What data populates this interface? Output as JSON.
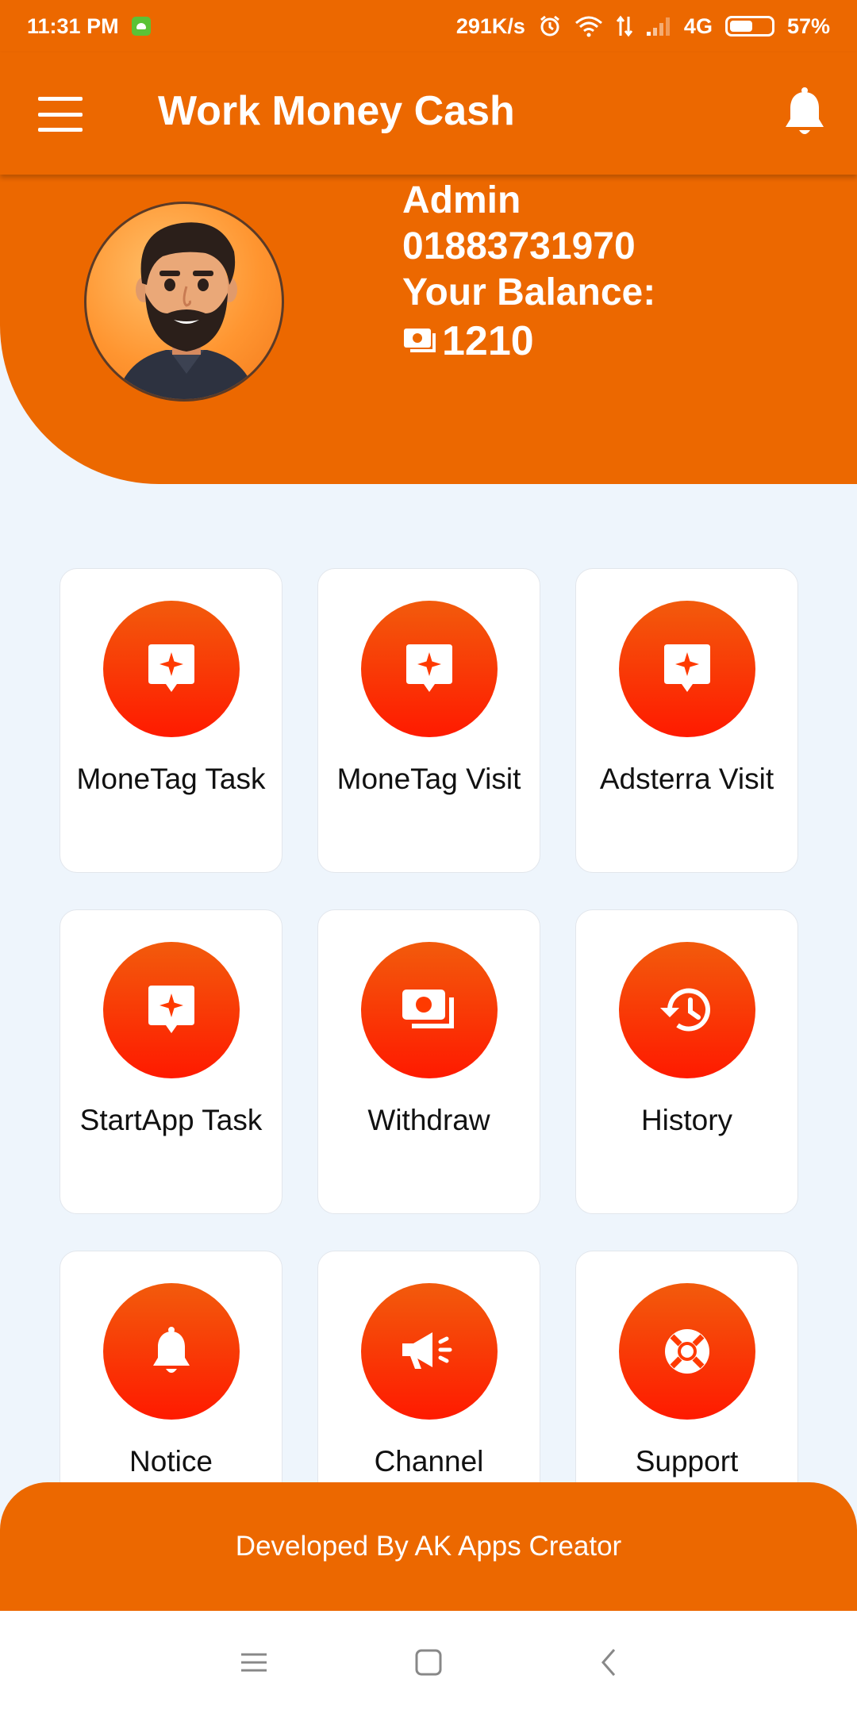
{
  "status_bar": {
    "time": "11:31 PM",
    "speed": "291K/s",
    "network": "4G",
    "battery": "57%",
    "battery_level": 0.57,
    "icons": [
      "android-notification-icon",
      "alarm-icon",
      "wifi-icon",
      "data-arrows-icon",
      "signal-icon",
      "battery-icon"
    ]
  },
  "app_bar": {
    "title": "Work Money Cash",
    "menu_icon": "hamburger-menu-icon",
    "notification_icon": "bell-icon"
  },
  "profile": {
    "name": "Admin",
    "phone": "01883731970",
    "balance_label": "Your Balance:",
    "balance": "1210",
    "balance_icon": "money-icon",
    "avatar": "bearded-man-avatar"
  },
  "grid": [
    {
      "label": "MoneTag Task",
      "icon": "message-star-icon"
    },
    {
      "label": "MoneTag Visit",
      "icon": "message-star-icon"
    },
    {
      "label": "Adsterra Visit",
      "icon": "message-star-icon"
    },
    {
      "label": "StartApp Task",
      "icon": "message-star-icon"
    },
    {
      "label": "Withdraw",
      "icon": "money-icon"
    },
    {
      "label": "History",
      "icon": "history-icon"
    },
    {
      "label": "Notice",
      "icon": "bell-icon"
    },
    {
      "label": "Channel",
      "icon": "megaphone-icon"
    },
    {
      "label": "Support",
      "icon": "lifebuoy-icon"
    }
  ],
  "footer": {
    "text": "Developed By AK Apps Creator"
  },
  "colors": {
    "primary": "#ec6800",
    "icon_gradient_top": "#f25b0c",
    "icon_gradient_bottom": "#ff1a00",
    "background": "#eef5fc"
  }
}
